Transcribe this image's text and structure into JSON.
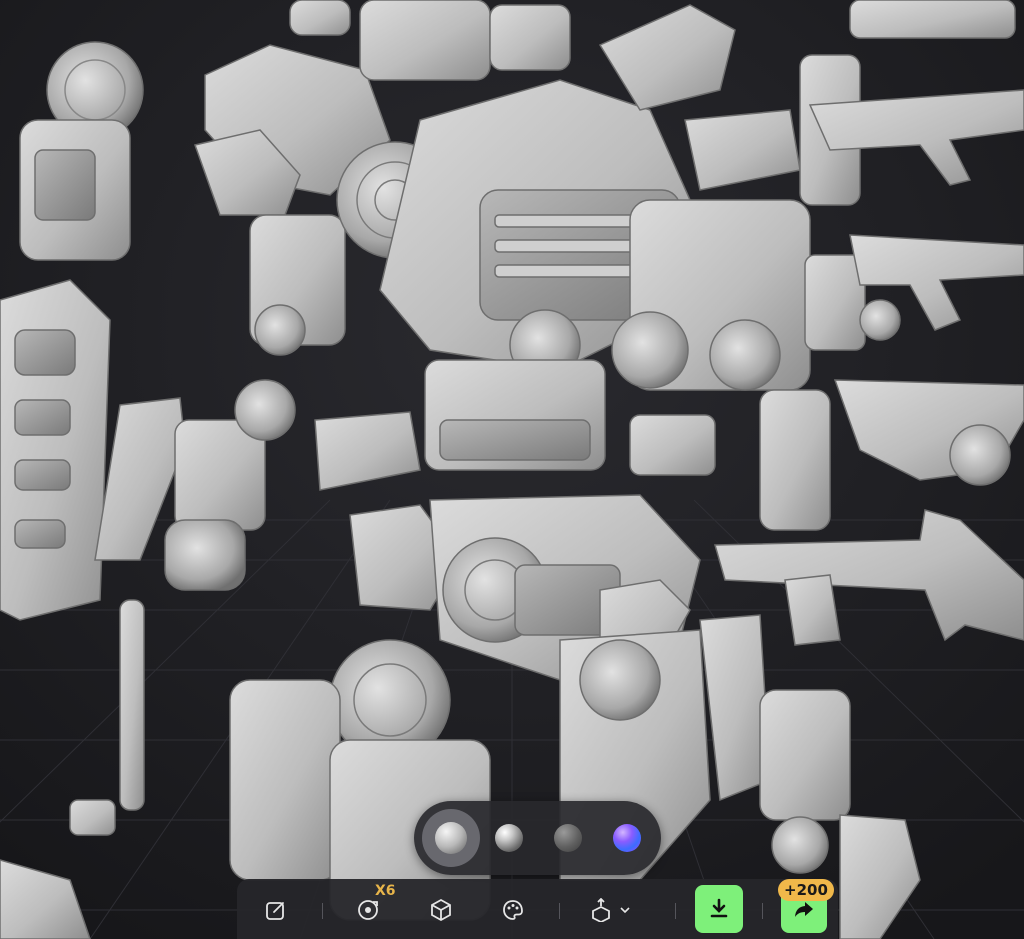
{
  "material_picker": {
    "selected": "matte-clay",
    "options": [
      "matte-clay",
      "glossy-metal",
      "dark-matte",
      "iridescent"
    ]
  },
  "toolbar": {
    "rotate_count_label": "X6",
    "share_reward_badge": "+200",
    "icons": [
      "edit-icon",
      "rotate-icon",
      "cube-icon",
      "palette-icon",
      "export-model-icon",
      "download-icon",
      "share-icon"
    ]
  },
  "colors": {
    "accent_green": "#7ef07a",
    "badge_gold": "#f0b84a",
    "label_gold": "#e8b54a",
    "background": "#1c1c20"
  }
}
